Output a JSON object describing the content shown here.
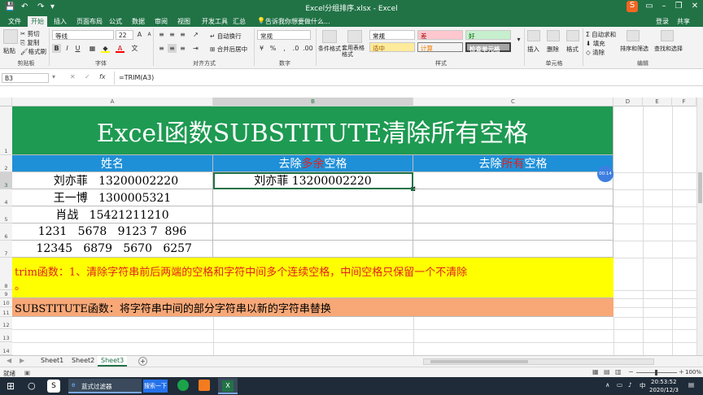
{
  "window": {
    "title": "Excel分组排序.xlsx - Excel",
    "controls": [
      "minimize-icon",
      "restore-icon",
      "close-icon"
    ]
  },
  "menu": {
    "tabs": [
      "文件",
      "开始",
      "插入",
      "页面布局",
      "公式",
      "数据",
      "审阅",
      "视图",
      "开发工具",
      "汇总"
    ],
    "active_tab": "开始",
    "tell_me": "告诉我你想要做什么...",
    "login": "登录",
    "share": "共享"
  },
  "ribbon": {
    "clipboard": {
      "paste": "粘贴",
      "cut": "剪切",
      "copy": "复制",
      "format_painter": "格式刷",
      "label": "剪贴板"
    },
    "font": {
      "name": "等线",
      "size": "22",
      "label": "字体"
    },
    "alignment": {
      "wrap": "自动换行",
      "merge": "合并后居中",
      "label": "对齐方式"
    },
    "number": {
      "format": "常规",
      "label": "数字"
    },
    "styles": {
      "conditional": "条件格式",
      "table": "套用表格格式",
      "normal": "常规",
      "bad": "差",
      "good": "好",
      "neutral": "适中",
      "calc": "计算",
      "check": "检查单元格",
      "label": "样式"
    },
    "cells": {
      "insert": "插入",
      "delete": "删除",
      "format": "格式",
      "label": "单元格"
    },
    "editing": {
      "autosum": "自动求和",
      "fill": "填充",
      "clear": "清除",
      "sort": "排序和筛选",
      "find": "查找和选择",
      "label": "编辑"
    }
  },
  "formula_bar": {
    "name_box": "B3",
    "fx": "fx",
    "formula": "=TRIM(A3)"
  },
  "grid": {
    "columns": [
      "A",
      "B",
      "C",
      "D",
      "E",
      "F"
    ],
    "selected_column": "B",
    "rows": [
      "1",
      "2",
      "3",
      "4",
      "5",
      "6",
      "7",
      "8",
      "9",
      "10",
      "11",
      "12",
      "13",
      "14"
    ],
    "selected_row": "3",
    "title": "Excel函数SUBSTITUTE清除所有空格",
    "headers": {
      "a": "姓名",
      "b_pre": "去除",
      "b_red": "多余",
      "b_post": "空格",
      "c_pre": "去除",
      "c_red": "所有",
      "c_post": "空格"
    },
    "data_a": [
      "  刘亦菲   13200002220",
      "王一博   1300005321",
      "肖战   15421211210",
      "1231   5678   9123 7  896",
      " 12345   6879   5670   6257"
    ],
    "data_b": [
      "刘亦菲 13200002220",
      "",
      "",
      "",
      ""
    ],
    "note_trim_line1": "trim函数：1、清除字符串前后两端的空格和字符中间多个连续空格，中间空格只保留一个不清除",
    "note_trim_line2": "。",
    "note_substitute": "SUBSTITUTE函数：将字符串中间的部分字符串以新的字符串替换",
    "timer": "00:14"
  },
  "sheets": {
    "tabs": [
      "Sheet1",
      "Sheet2",
      "Sheet3"
    ],
    "active": "Sheet3",
    "add": "+"
  },
  "status": {
    "mode": "就绪",
    "zoom": "100%"
  },
  "taskbar": {
    "search_app": "蓝式过滤器",
    "search_box": "搜索一下",
    "time": "20:53:52",
    "date": "2020/12/3"
  },
  "colors": {
    "excel_green": "#217346",
    "title_green": "#1e9a52",
    "header_blue": "#1e90d8",
    "note_yellow": "#ffff00",
    "note_red_text": "#e02020",
    "note_orange": "#f8a877"
  }
}
